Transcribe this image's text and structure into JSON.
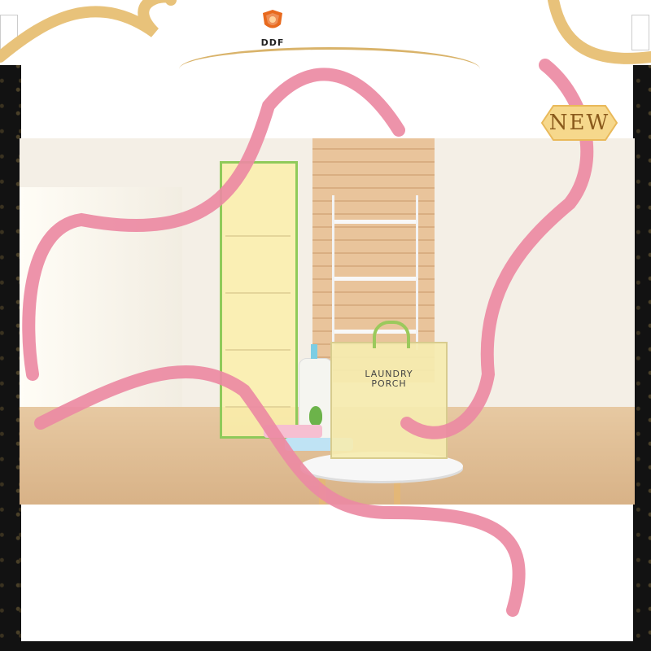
{
  "brand": {
    "name": "DDF",
    "logo_icon": "shield-crest-icon",
    "color": "#e86a1e"
  },
  "badge": {
    "text": "NEW",
    "color": "#f3c86a"
  },
  "product": {
    "bag_label_line1": "LAUNDRY",
    "bag_label_line2": "PORCH"
  },
  "colors": {
    "ribbon_pink": "#ec8aa3",
    "ribbon_gold": "#e8c27a",
    "frame_dark": "#121212"
  }
}
